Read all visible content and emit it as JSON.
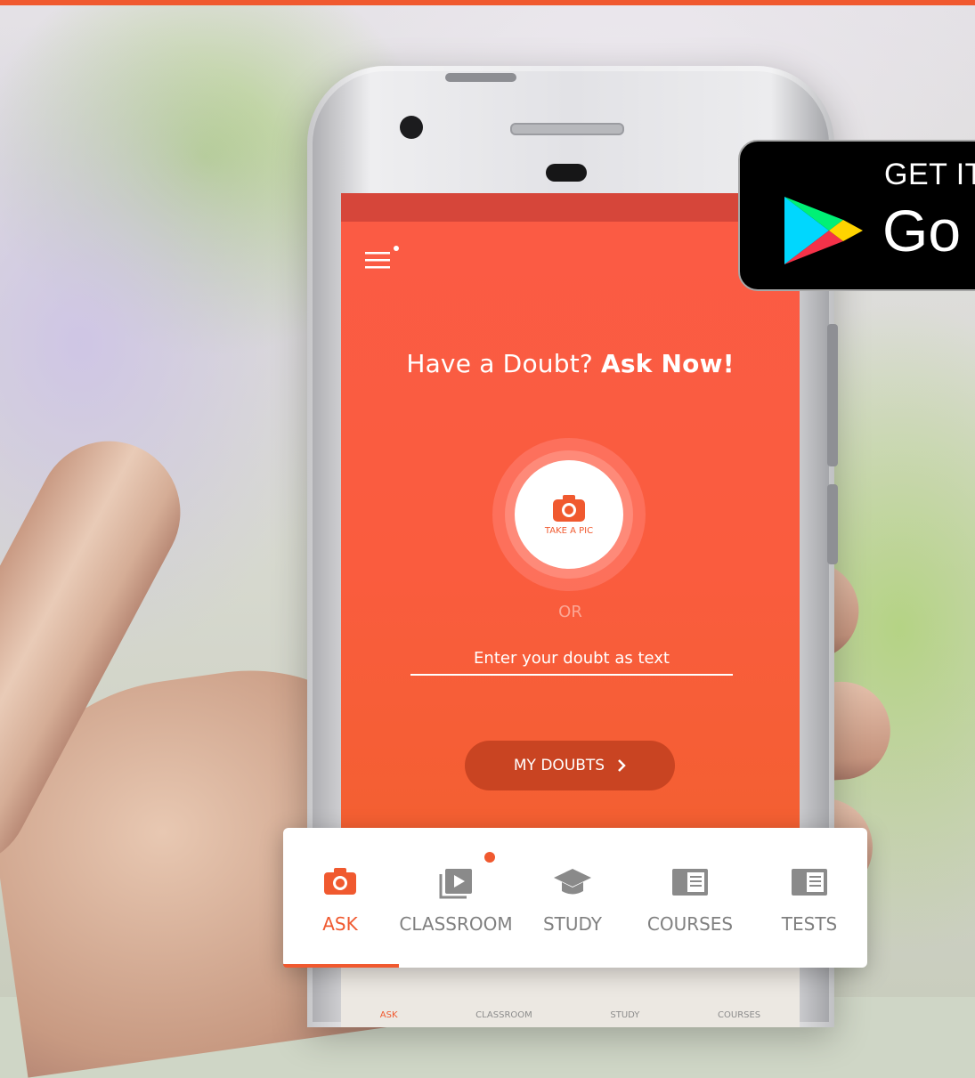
{
  "screen": {
    "headline_lead": "Have a Doubt?",
    "headline_cta": "Ask Now!",
    "take_pic_label": "TAKE A PIC",
    "or_text": "OR",
    "doubt_input_placeholder": "Enter your doubt as text",
    "my_doubts_label": "MY DOUBTS",
    "phone_tabs": [
      "ASK",
      "CLASSROOM",
      "STUDY",
      "COURSES"
    ]
  },
  "badge": {
    "small_text": "GET IT",
    "big_text": "Go"
  },
  "bottom_nav": {
    "items": [
      {
        "label": "ASK",
        "icon": "camera-icon",
        "active": true
      },
      {
        "label": "CLASSROOM",
        "icon": "video-play-icon",
        "active": false
      },
      {
        "label": "STUDY",
        "icon": "graduation-cap-icon",
        "active": false
      },
      {
        "label": "COURSES",
        "icon": "book-icon",
        "active": false
      },
      {
        "label": "TESTS",
        "icon": "test-paper-icon",
        "active": false
      }
    ]
  },
  "colors": {
    "accent": "#f0592f",
    "screen_top": "#fb5b45",
    "screen_bottom": "#ef6228",
    "status_bar": "#d6463a",
    "button_dark": "#c94422",
    "inactive_gray": "#808080"
  }
}
